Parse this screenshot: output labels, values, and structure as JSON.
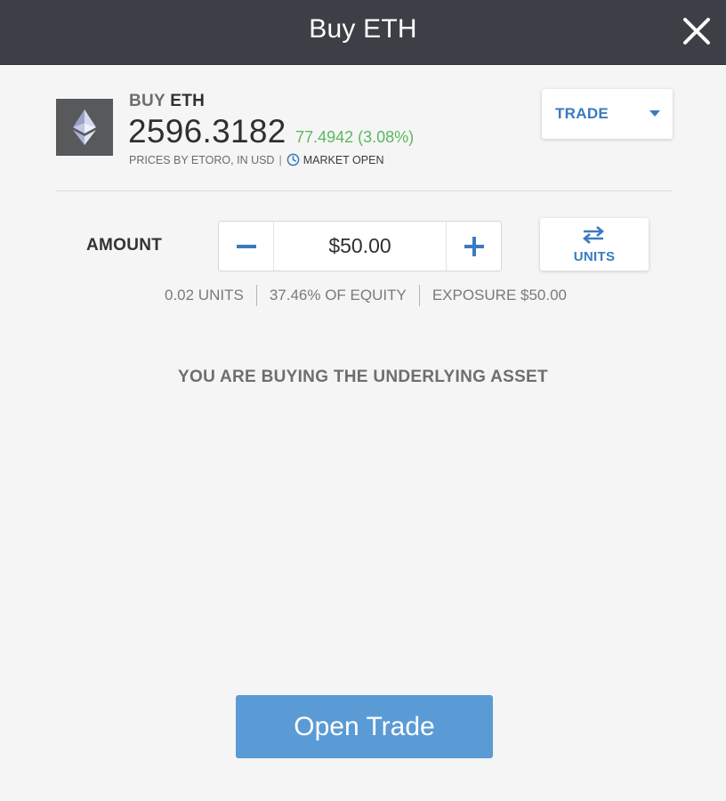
{
  "header": {
    "title": "Buy ETH",
    "close_icon": "close-icon"
  },
  "asset": {
    "action": "BUY",
    "symbol": "ETH",
    "icon": "ethereum-icon",
    "price": "2596.3182",
    "change": "77.4942 (3.08%)",
    "prices_source": "PRICES BY ETORO, IN USD",
    "separator": "|",
    "market_status": "MARKET OPEN",
    "clock_icon": "clock-icon"
  },
  "trade_dropdown": {
    "label": "TRADE",
    "caret_icon": "caret-down-icon"
  },
  "amount": {
    "label": "AMOUNT",
    "value": "$50.00",
    "minus_icon": "minus-icon",
    "plus_icon": "plus-icon"
  },
  "units_toggle": {
    "label": "UNITS",
    "icon": "swap-arrows-icon"
  },
  "summary": {
    "units": "0.02 UNITS",
    "equity": "37.46% OF EQUITY",
    "exposure": "EXPOSURE $50.00"
  },
  "info_message": "YOU ARE BUYING THE UNDERLYING ASSET",
  "open_trade_button": "Open Trade",
  "colors": {
    "header_bg": "#3c3f45",
    "accent_blue": "#3a7bbf",
    "positive_green": "#5cb85c",
    "button_blue": "#5b9bd5",
    "page_bg": "#f5f5f5"
  }
}
